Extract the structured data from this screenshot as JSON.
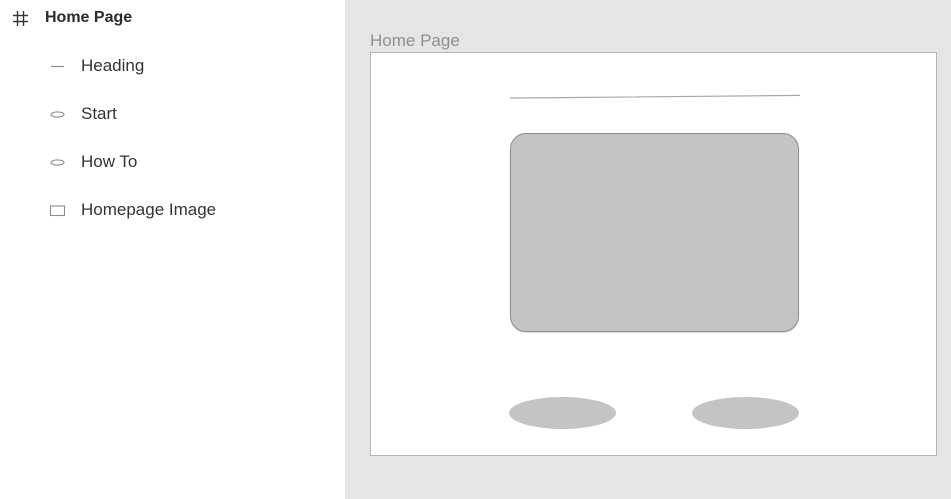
{
  "layers": {
    "frame": {
      "label": "Home Page",
      "icon": "frame-hash-icon"
    },
    "items": [
      {
        "label": "Heading",
        "icon": "line-icon"
      },
      {
        "label": "Start",
        "icon": "ellipse-icon"
      },
      {
        "label": "How To",
        "icon": "ellipse-icon"
      },
      {
        "label": "Homepage Image",
        "icon": "rectangle-icon"
      }
    ]
  },
  "canvas": {
    "frame_title": "Home Page"
  },
  "colors": {
    "canvas_bg": "#e5e5e5",
    "shape_fill": "#c4c4c4",
    "shape_stroke": "#8f8f8f",
    "frame_title": "#8f8f8f"
  }
}
